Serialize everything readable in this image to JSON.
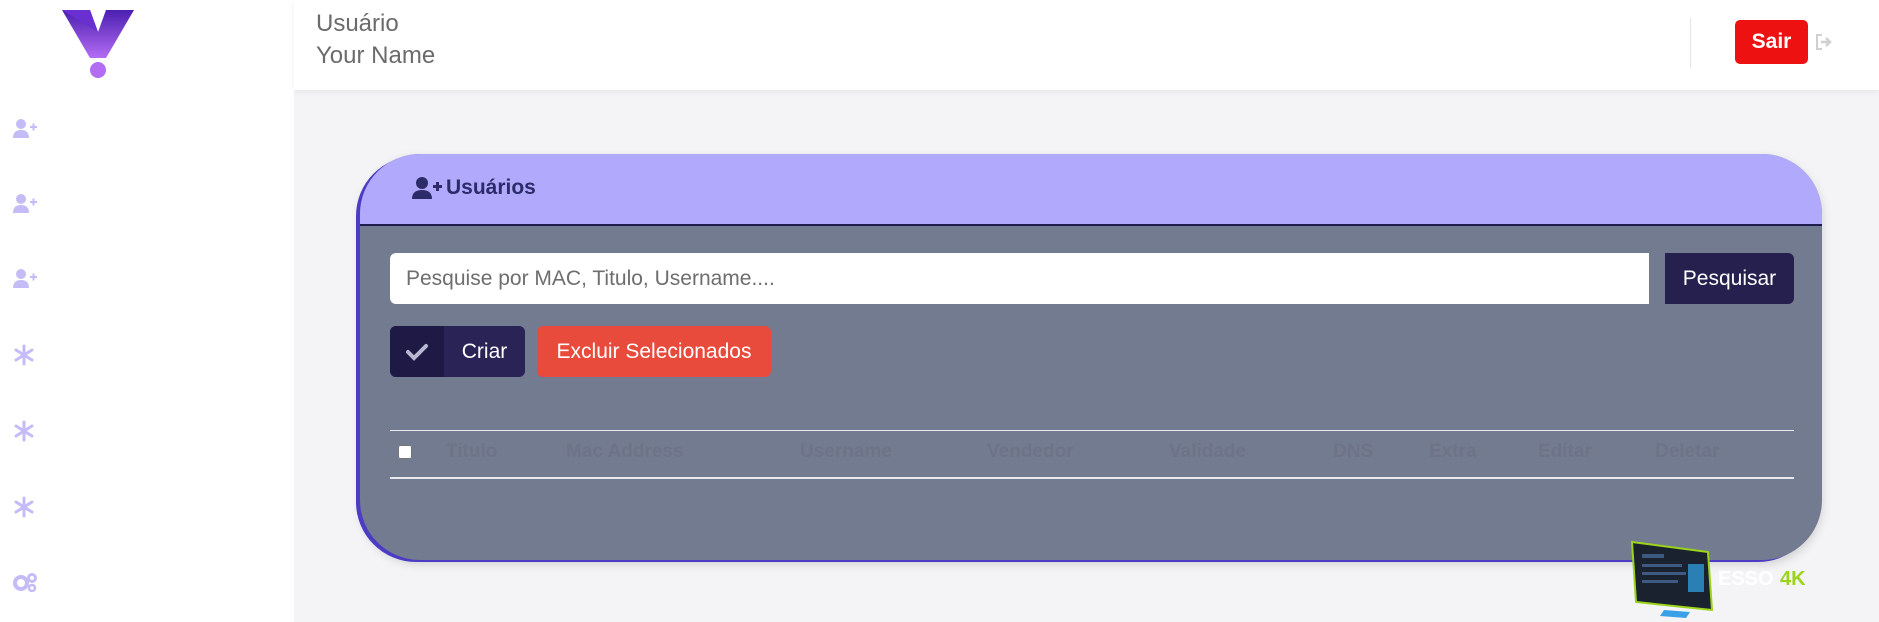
{
  "sidebar": {
    "items": [
      {
        "icon": "user-plus-icon"
      },
      {
        "icon": "user-plus-icon"
      },
      {
        "icon": "user-plus-icon"
      },
      {
        "icon": "asterisk-icon"
      },
      {
        "icon": "asterisk-icon"
      },
      {
        "icon": "asterisk-icon"
      },
      {
        "icon": "cogs-icon"
      }
    ]
  },
  "header": {
    "user_label": "Usuário",
    "user_name": "Your Name",
    "logout_label": "Sair"
  },
  "card": {
    "title": "Usuários",
    "search_placeholder": "Pesquise por MAC, Titulo, Username....",
    "search_button": "Pesquisar",
    "create_button": "Criar",
    "delete_button": "Excluir Selecionados"
  },
  "table": {
    "columns": [
      "Titulo",
      "Mac Address",
      "Username",
      "Vendedor",
      "Validade",
      "DNS",
      "Extra",
      "Editar",
      "Deletar"
    ]
  },
  "badge": {
    "text": "ESSO",
    "suffix": "4K"
  },
  "colors": {
    "accent": "#b0a9fc",
    "card_body": "#737b90",
    "dark_button": "#25204e",
    "danger": "#e84a3c",
    "logout": "#ee1111"
  }
}
